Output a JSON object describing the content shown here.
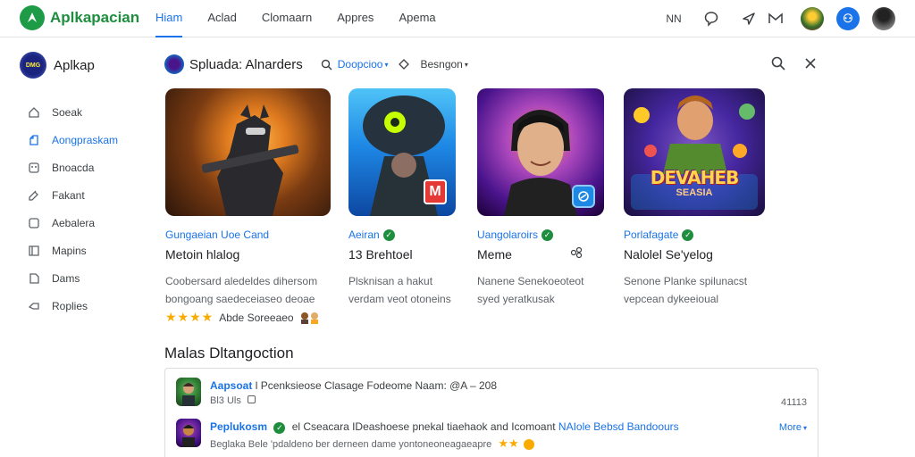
{
  "app": {
    "name": "Aplkapacian"
  },
  "nav": [
    {
      "label": "Hiam",
      "active": true
    },
    {
      "label": "Aclad",
      "active": false
    },
    {
      "label": "Clomaarn",
      "active": false
    },
    {
      "label": "Appres",
      "active": false
    },
    {
      "label": "Apema",
      "active": false
    }
  ],
  "topbar": {
    "text_icon": "NN"
  },
  "sidebar": {
    "title": "Aplkap",
    "logo_text": "DMG",
    "items": [
      {
        "label": "Soeak",
        "icon": "home-icon"
      },
      {
        "label": "Aongpraskam",
        "icon": "apps-icon",
        "active": true
      },
      {
        "label": "Bnoacda",
        "icon": "games-icon"
      },
      {
        "label": "Fakant",
        "icon": "edit-icon"
      },
      {
        "label": "Aebalera",
        "icon": "square-icon"
      },
      {
        "label": "Mapins",
        "icon": "book-icon"
      },
      {
        "label": "Dams",
        "icon": "file-icon"
      },
      {
        "label": "Roplies",
        "icon": "reply-icon"
      }
    ]
  },
  "search": {
    "title": "Spluada: Alnarders",
    "filter_primary": "Doopcioo",
    "filter_secondary": "Besngon"
  },
  "cards": [
    {
      "developer": "Gungaeian Uoe Cand",
      "title": "Metoin hlalog",
      "desc1": "Coobersard aledeldes dihersom",
      "desc2": "bongoang saedeceiaseo deoae",
      "rating_text": "Abde Soreeaeo",
      "verified": false
    },
    {
      "developer": "Aeiran",
      "title": "13 Brehtoel",
      "desc1": "Plsknisan a hakut",
      "desc2": "verdam veot otoneins",
      "verified": true,
      "badge": "M"
    },
    {
      "developer": "Uangolaroirs",
      "title": "Meme",
      "desc1": "Nanene Senekoeoteot",
      "desc2": "syed yeratkusak",
      "verified": true
    },
    {
      "developer": "Porlafagate",
      "title": "Nalolel Se'yelog",
      "desc1": "Senone Planke spilunacst",
      "desc2": "vepcean dykeeioual",
      "verified": true,
      "art_text_1": "DEVAHEB",
      "art_text_2": "SEASIA"
    }
  ],
  "more": {
    "title": "Malas Dltangoction",
    "rows": [
      {
        "name": "Aapsoat",
        "text": "l  Pcenksieose  Clasage Fodeome Naam: @A – 208",
        "sub": "Bl3 Uls",
        "right": "41113"
      },
      {
        "name": "Peplukosm",
        "text": "el Cseacara IDeashoese pnekal tiaehaok and Icomoant",
        "highlight": "NAIole Bebsd Bandoours",
        "sub": "Beglaka Bele 'pdaldeno ber derneen dame yontoneoneagaeapre",
        "right": "More"
      }
    ]
  },
  "colors": {
    "accent": "#1a73e8",
    "brand": "#1e8e3e",
    "star": "#f9ab00"
  }
}
